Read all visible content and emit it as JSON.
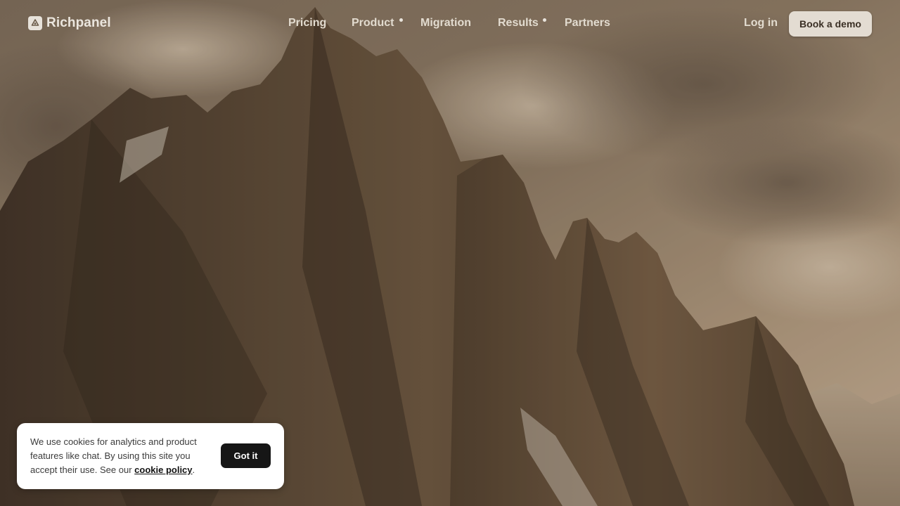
{
  "brand": {
    "name": "Richpanel",
    "icon": "recycle-logo-icon"
  },
  "nav": {
    "links": [
      {
        "label": "Pricing",
        "has_dot": false
      },
      {
        "label": "Product",
        "has_dot": true
      },
      {
        "label": "Migration",
        "has_dot": false
      },
      {
        "label": "Results",
        "has_dot": true
      },
      {
        "label": "Partners",
        "has_dot": false
      }
    ],
    "login_label": "Log in",
    "cta_label": "Book a demo"
  },
  "cookie_banner": {
    "text_before_link": "We use cookies for analytics and product features like chat. By using this site you accept their use. See our ",
    "link_label": "cookie policy",
    "text_after_link": ".",
    "button_label": "Got it"
  },
  "colors": {
    "sky": "#8a7760",
    "rock": "#4a3a2a",
    "cta_bg": "#e3dcd2",
    "cookie_button": "#161616"
  }
}
